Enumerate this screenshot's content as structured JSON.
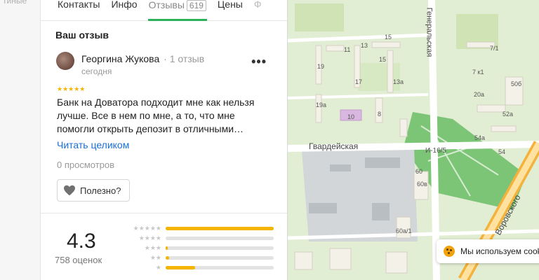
{
  "left_strip": {
    "fragment": "тиные"
  },
  "tabs": [
    {
      "label": "Контакты"
    },
    {
      "label": "Инфо"
    },
    {
      "label": "Отзывы",
      "count": "619"
    },
    {
      "label": "Цены"
    },
    {
      "label": "Ф"
    }
  ],
  "review_section": {
    "title": "Ваш отзыв",
    "author": "Георгина Жукова",
    "author_reviews": "· 1 отзыв",
    "date": "сегодня",
    "more": "•••",
    "stars": "★★★★★",
    "rating": 5,
    "text": "Банк на Доватора подходит мне как нельзя лучше. Все в нем по мне, а то, что мне помогли открыть депозит в отличными…",
    "read_more": "Читать целиком",
    "views": "0 просмотров",
    "useful": "Полезно?"
  },
  "summary": {
    "rating": "4.3",
    "ratings_count": "758 оценок",
    "distribution": [
      {
        "stars": "★★★★★",
        "fraction": 1.0
      },
      {
        "stars": "★★★★",
        "fraction": 0.0
      },
      {
        "stars": "★★★",
        "fraction": 0.02
      },
      {
        "stars": "★★",
        "fraction": 0.03
      },
      {
        "stars": "★",
        "fraction": 0.27
      }
    ]
  },
  "map": {
    "street_1": "Гвардейская",
    "street_2": "Воровского",
    "street_3": "Генеральская",
    "labels": [
      "13",
      "15",
      "11",
      "19",
      "17",
      "13а",
      "15",
      "19а",
      "10",
      "8",
      "7/1",
      "7 к1",
      "50б",
      "20а",
      "52а",
      "54а",
      "54",
      "60",
      "60в",
      "60а/1",
      "И-16/5"
    ],
    "cookie": "Мы используем cookie"
  },
  "colors": {
    "accent": "#2ab15a",
    "link": "#1a6fd6",
    "star": "#f4b400"
  }
}
